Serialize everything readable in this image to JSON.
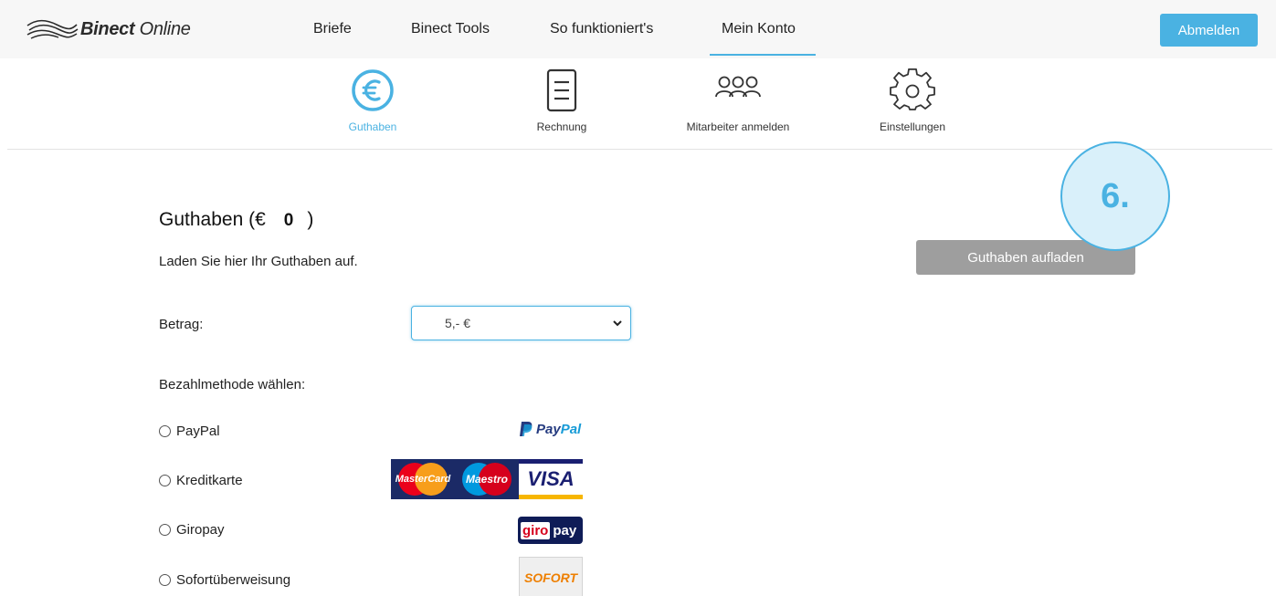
{
  "brand": {
    "name_bold": "Binect",
    "name_light": " Online"
  },
  "nav": {
    "items": [
      {
        "label": "Briefe"
      },
      {
        "label": "Binect Tools"
      },
      {
        "label": "So funktioniert's"
      },
      {
        "label": "Mein Konto",
        "active": true
      }
    ],
    "logout_label": "Abmelden"
  },
  "subnav": {
    "items": [
      {
        "label": "Guthaben",
        "icon": "euro-icon",
        "active": true
      },
      {
        "label": "Rechnung",
        "icon": "invoice-icon"
      },
      {
        "label": "Mitarbeiter anmelden",
        "icon": "users-icon"
      },
      {
        "label": "Einstellungen",
        "icon": "gear-icon"
      }
    ]
  },
  "annotation": {
    "step": "6."
  },
  "content": {
    "title_prefix": "Guthaben (€",
    "balance": "0",
    "title_suffix": ")",
    "intro": "Laden Sie hier Ihr Guthaben auf.",
    "topup_button": "Guthaben aufladen",
    "amount_label": "Betrag:",
    "amount_value": "5,- €",
    "payment_heading": "Bezahlmethode wählen:",
    "methods": [
      {
        "label": "PayPal",
        "logo": "paypal-logo"
      },
      {
        "label": "Kreditkarte",
        "logo": "mastercard-maestro-visa-logos"
      },
      {
        "label": "Giropay",
        "logo": "giropay-logo"
      },
      {
        "label": "Sofortüberweisung",
        "logo": "sofort-logo"
      }
    ]
  },
  "logos": {
    "paypal_a": "Pay",
    "paypal_b": "Pal",
    "mastercard": "MasterCard",
    "maestro": "Maestro",
    "visa": "VISA",
    "giro_a": "giro",
    "giro_b": "pay",
    "sofort": "SOFORT"
  },
  "colors": {
    "accent": "#4ab2e2",
    "button_disabled": "#9e9e9e",
    "topbar": "#f7f7f7"
  }
}
